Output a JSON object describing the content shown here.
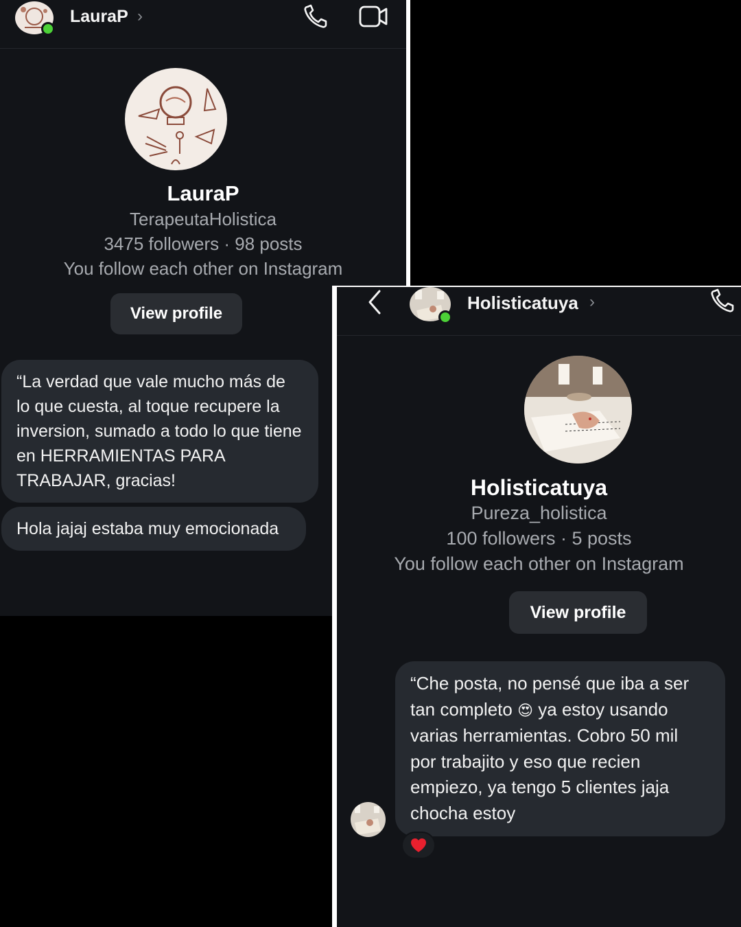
{
  "chat1": {
    "header": {
      "name": "LauraP",
      "chevron": "›",
      "icons": [
        "phone-icon",
        "video-camera-icon"
      ]
    },
    "profile": {
      "name": "LauraP",
      "username": "TerapeutaHolistica",
      "stats": "3475 followers · 98 posts",
      "relation": "You follow each other on Instagram",
      "view_profile_label": "View profile"
    },
    "messages": [
      {
        "text": "“La verdad que vale mucho más de lo que cuesta, al toque recupere la inversion, sumado a todo lo que tiene en HERRAMIENTAS PARA TRABAJAR, gracias!"
      },
      {
        "text": "Hola jajaj estaba muy emocionada"
      }
    ]
  },
  "chat2": {
    "header": {
      "name": "Holisticatuya",
      "chevron": "›",
      "icons": [
        "back-arrow-icon",
        "phone-icon"
      ]
    },
    "profile": {
      "name": "Holisticatuya",
      "username": "Pureza_holistica",
      "stats": "100 followers · 5 posts",
      "relation": "You follow each other on Instagram",
      "view_profile_label": "View profile"
    },
    "message": {
      "line1": "“Che posta, no pensé que iba a ser",
      "line2a": "tan completo ",
      "emoji": "😍",
      "line2b": " ya estoy usando",
      "line3": "varias herramientas. Cobro 50 mil",
      "line4": "por trabajito y eso que recien",
      "line5": "empiezo, ya tengo 5 clientes jaja",
      "line6": "chocha estoy"
    },
    "reaction": "heart-emoji",
    "colors": {
      "online": "#4cd137",
      "heart": "#e8202e"
    }
  }
}
